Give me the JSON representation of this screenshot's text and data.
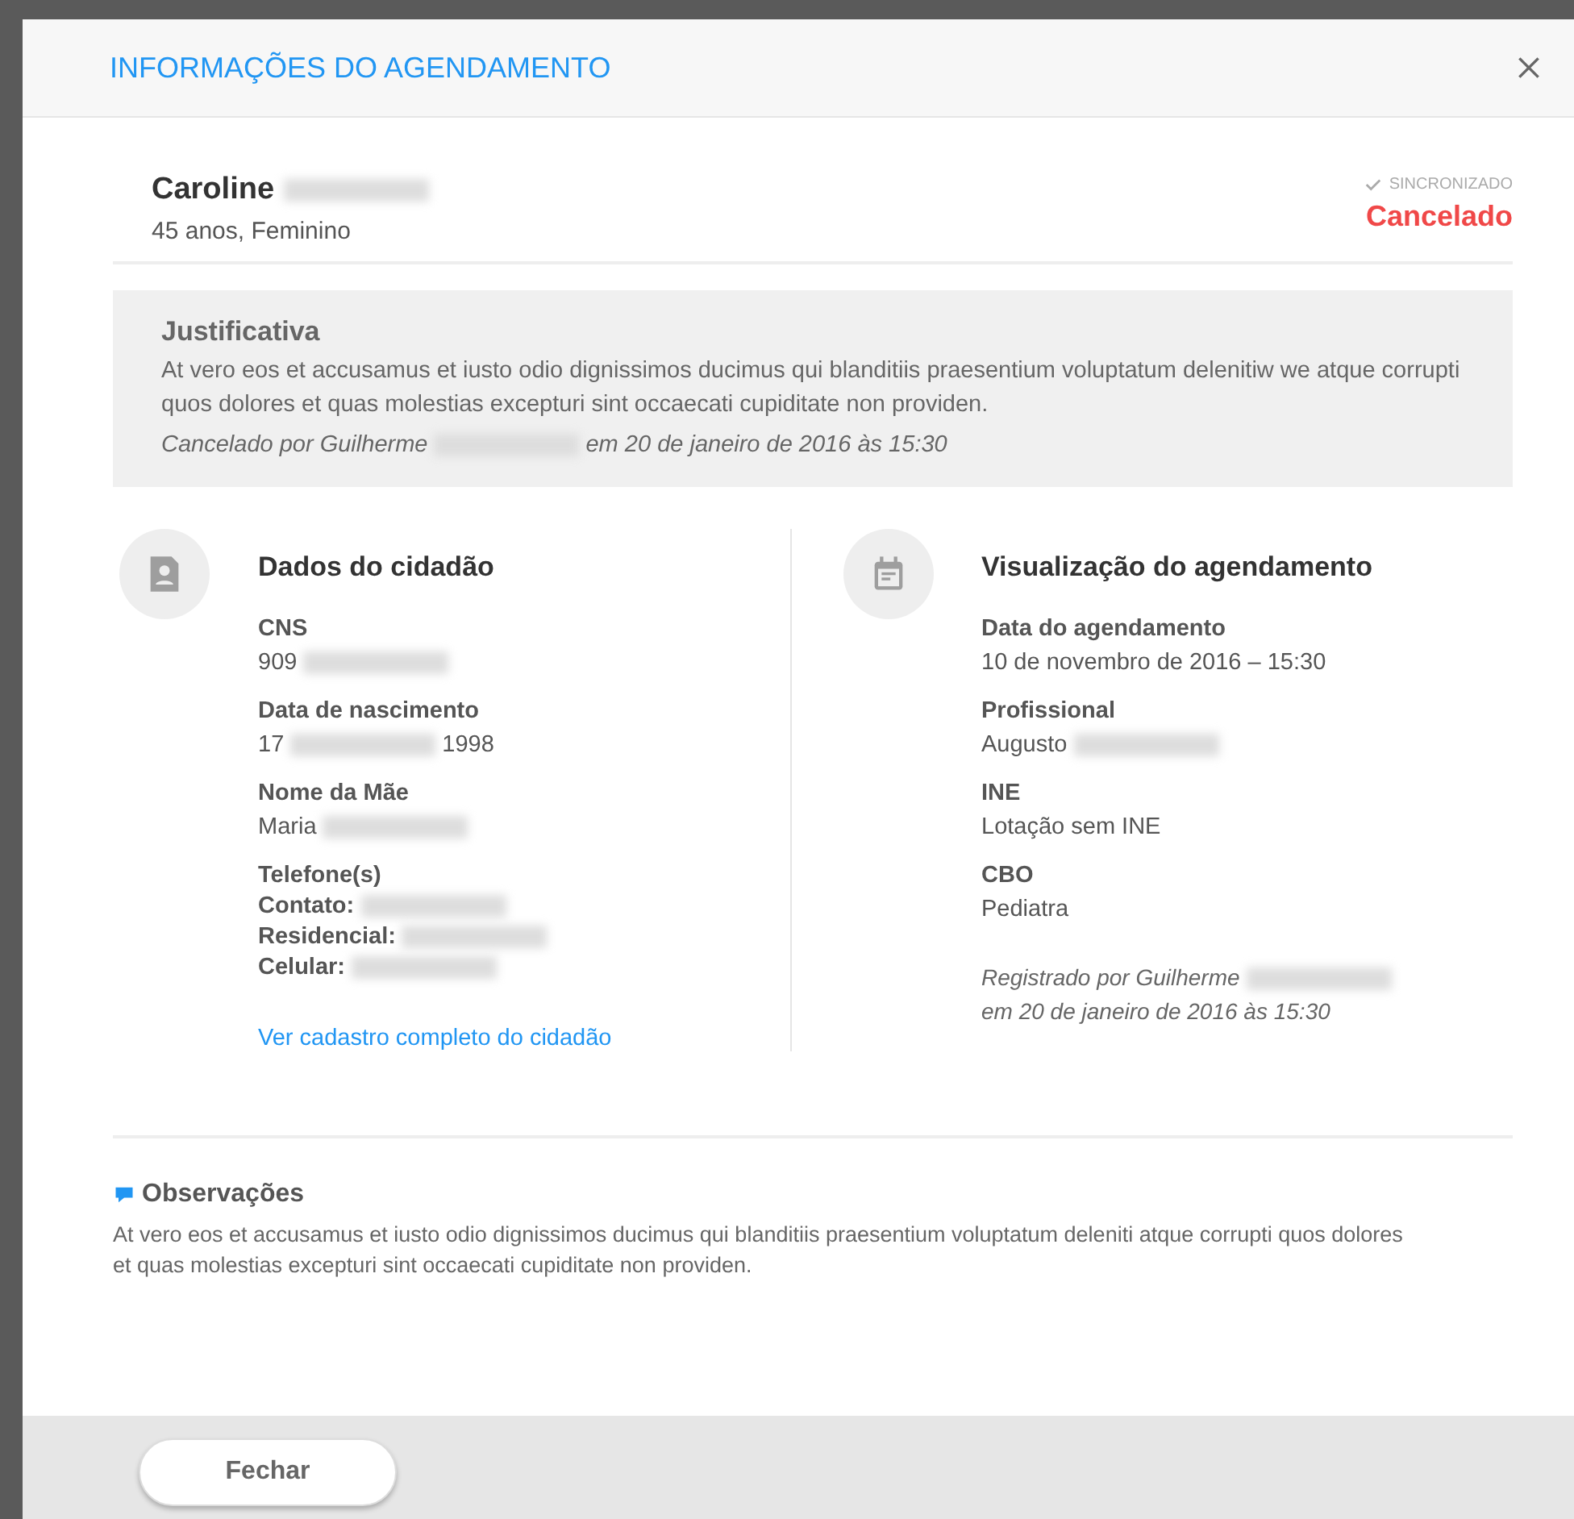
{
  "window": {
    "title": "INFORMAÇÕES DO AGENDAMENTO"
  },
  "patient": {
    "name": [
      {
        "kind": "text",
        "text": "Caroline"
      },
      {
        "kind": "redacted"
      }
    ],
    "details": "45 anos, Feminino",
    "sync": {
      "label": "SINCRONIZADO"
    },
    "status": "Cancelado"
  },
  "justification": {
    "title": "Justificativa",
    "text": "At vero eos et accusamus et iusto odio dignissimos ducimus qui blanditiis praesentium voluptatum delenitiw we atque corrupti quos dolores et quas molestias excepturi sint occaecati cupiditate non providen.",
    "footer": [
      {
        "kind": "text",
        "text": "Cancelado por Guilherme"
      },
      {
        "kind": "redacted"
      },
      {
        "kind": "text",
        "text": "em 20 de janeiro de 2016 às 15:30"
      }
    ]
  },
  "citizen": {
    "title": "Dados do cidadão",
    "fields": [
      {
        "label": "CNS",
        "value": [
          {
            "kind": "text",
            "text": "909"
          },
          {
            "kind": "redacted"
          }
        ]
      },
      {
        "label": "Data de nascimento",
        "value": [
          {
            "kind": "text",
            "text": "17"
          },
          {
            "kind": "redacted"
          },
          {
            "kind": "text",
            "text": "1998"
          }
        ]
      },
      {
        "label": "Nome da Mãe",
        "value": [
          {
            "kind": "text",
            "text": "Maria"
          },
          {
            "kind": "redacted"
          }
        ]
      }
    ],
    "phones_title": "Telefone(s)",
    "phones": [
      {
        "label": "Contato:",
        "value": [
          {
            "kind": "redacted"
          }
        ]
      },
      {
        "label": "Residencial:",
        "value": [
          {
            "kind": "redacted"
          }
        ]
      },
      {
        "label": "Celular:",
        "value": [
          {
            "kind": "redacted"
          }
        ]
      }
    ],
    "link": "Ver cadastro completo do cidadão"
  },
  "appointment": {
    "title": "Visualização do agendamento",
    "fields": [
      {
        "label": "Data do agendamento",
        "value": [
          {
            "kind": "text",
            "text": "10 de novembro de 2016 – 15:30"
          }
        ]
      },
      {
        "label": "Profissional",
        "value": [
          {
            "kind": "text",
            "text": "Augusto"
          },
          {
            "kind": "redacted"
          }
        ]
      },
      {
        "label": "INE",
        "value": [
          {
            "kind": "text",
            "text": "Lotação sem INE"
          }
        ]
      },
      {
        "label": "CBO",
        "value": [
          {
            "kind": "text",
            "text": "Pediatra"
          }
        ]
      }
    ],
    "note": [
      [
        {
          "kind": "text",
          "text": "Registrado por Guilherme"
        },
        {
          "kind": "redacted"
        }
      ],
      [
        {
          "kind": "text",
          "text": "em 20 de janeiro de 2016 às 15:30"
        }
      ]
    ]
  },
  "observations": {
    "title": "Observações",
    "text": "At vero eos et accusamus et iusto odio dignissimos ducimus qui blanditiis praesentium voluptatum deleniti atque corrupti quos dolores et quas molestias excepturi sint occaecati cupiditate non providen."
  },
  "buttons": [
    "Fechar"
  ]
}
